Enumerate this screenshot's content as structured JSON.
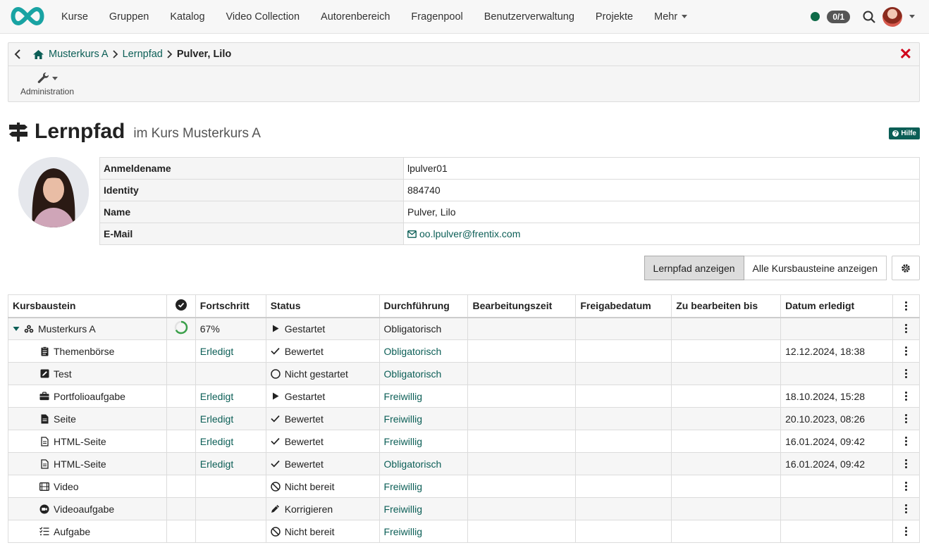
{
  "nav": {
    "items": [
      {
        "label": "Kurse"
      },
      {
        "label": "Gruppen"
      },
      {
        "label": "Katalog"
      },
      {
        "label": "Video Collection"
      },
      {
        "label": "Autorenbereich"
      },
      {
        "label": "Fragenpool"
      },
      {
        "label": "Benutzerverwaltung"
      },
      {
        "label": "Projekte"
      },
      {
        "label": "Mehr"
      }
    ],
    "count_badge": "0/1",
    "status_color": "#0d6a47"
  },
  "breadcrumb": {
    "items": [
      "Musterkurs A",
      "Lernpfad"
    ],
    "current": "Pulver, Lilo"
  },
  "toolbar": {
    "admin_label": "Administration"
  },
  "title": {
    "main": "Lernpfad",
    "sub": "im Kurs Musterkurs A",
    "help": "Hilfe"
  },
  "user_info": [
    {
      "key": "Anmeldename",
      "value": "lpulver01"
    },
    {
      "key": "Identity",
      "value": "884740"
    },
    {
      "key": "Name",
      "value": "Pulver, Lilo"
    },
    {
      "key": "E-Mail",
      "value": "oo.lpulver@frentix.com"
    }
  ],
  "view": {
    "btn_learnpath": "Lernpfad anzeigen",
    "btn_all": "Alle Kursbausteine anzeigen"
  },
  "table": {
    "headers": [
      "Kursbaustein",
      "",
      "Fortschritt",
      "Status",
      "Durchführung",
      "Bearbeitungszeit",
      "Freigabedatum",
      "Zu bearbeiten bis",
      "Datum erledigt",
      ""
    ],
    "rows": [
      {
        "name": "Musterkurs A",
        "icon": "course-icon",
        "progress": "67%",
        "progress_value": 0.67,
        "status": "Gestartet",
        "status_icon": "play-icon",
        "mode": "Obligatorisch",
        "done": ""
      },
      {
        "name": "Themenbörse",
        "icon": "clipboard-icon",
        "progress": "Erledigt",
        "status": "Bewertet",
        "status_icon": "check-icon",
        "mode": "Obligatorisch",
        "done": "12.12.2024, 18:38"
      },
      {
        "name": "Test",
        "icon": "test-icon",
        "progress": "",
        "status": "Nicht gestartet",
        "status_icon": "circle-icon",
        "mode": "Obligatorisch",
        "done": ""
      },
      {
        "name": "Portfolioaufgabe",
        "icon": "briefcase-icon",
        "progress": "Erledigt",
        "status": "Gestartet",
        "status_icon": "play-icon",
        "mode": "Freiwillig",
        "done": "18.10.2024, 15:28"
      },
      {
        "name": "Seite",
        "icon": "file-icon",
        "progress": "Erledigt",
        "status": "Bewertet",
        "status_icon": "check-icon",
        "mode": "Freiwillig",
        "done": "20.10.2023, 08:26"
      },
      {
        "name": "HTML-Seite",
        "icon": "file-outline-icon",
        "progress": "Erledigt",
        "status": "Bewertet",
        "status_icon": "check-icon",
        "mode": "Freiwillig",
        "done": "16.01.2024, 09:42"
      },
      {
        "name": "HTML-Seite",
        "icon": "file-outline-icon",
        "progress": "Erledigt",
        "status": "Bewertet",
        "status_icon": "check-icon",
        "mode": "Obligatorisch",
        "done": "16.01.2024, 09:42"
      },
      {
        "name": "Video",
        "icon": "film-icon",
        "progress": "",
        "status": "Nicht bereit",
        "status_icon": "ban-icon",
        "mode": "Freiwillig",
        "done": ""
      },
      {
        "name": "Videoaufgabe",
        "icon": "video-task-icon",
        "progress": "",
        "status": "Korrigieren",
        "status_icon": "pen-icon",
        "mode": "Freiwillig",
        "done": ""
      },
      {
        "name": "Aufgabe",
        "icon": "task-list-icon",
        "progress": "",
        "status": "Nicht bereit",
        "status_icon": "ban-icon",
        "mode": "Freiwillig",
        "done": ""
      }
    ]
  }
}
